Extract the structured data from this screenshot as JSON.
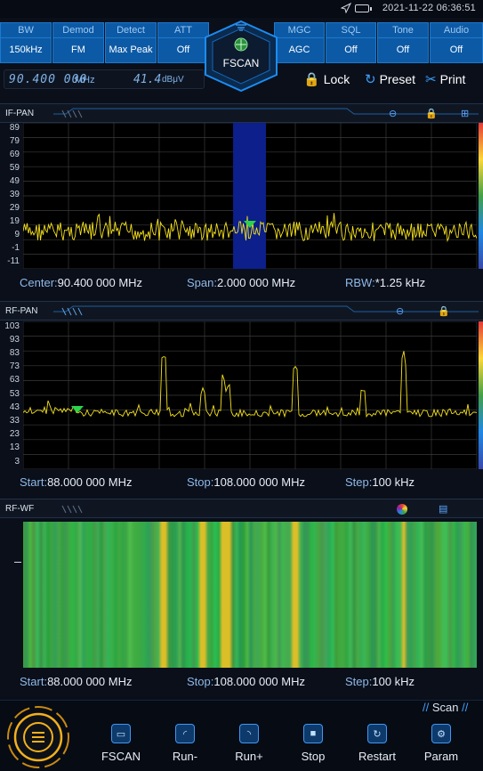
{
  "status": {
    "datetime": "2021-11-22 06:36:51"
  },
  "params": [
    {
      "label": "BW",
      "value": "150kHz"
    },
    {
      "label": "Demod",
      "value": "FM"
    },
    {
      "label": "Detect",
      "value": "Max Peak"
    },
    {
      "label": "ATT",
      "value": "Off"
    },
    {
      "label": "MGC",
      "value": "AGC"
    },
    {
      "label": "SQL",
      "value": "Off"
    },
    {
      "label": "Tone",
      "value": "Off"
    },
    {
      "label": "Audio",
      "value": "Off"
    }
  ],
  "mode": "FSCAN",
  "readout": {
    "freq": "90.400 000",
    "freq_unit": "MHz",
    "level": "41.4",
    "level_unit": "dBμV"
  },
  "actions": {
    "lock": "Lock",
    "preset": "Preset",
    "print": "Print"
  },
  "if_pan": {
    "title": "IF-PAN",
    "y_ticks": [
      "89",
      "79",
      "69",
      "59",
      "49",
      "39",
      "29",
      "19",
      "9",
      "-1",
      "-11"
    ],
    "center_label": "Center:",
    "center_value": "90.400 000 MHz",
    "span_label": "Span:",
    "span_value": "2.000 000 MHz",
    "rbw_label": "RBW:",
    "rbw_value": "*1.25 kHz"
  },
  "rf_pan": {
    "title": "RF-PAN",
    "y_ticks": [
      "103",
      "93",
      "83",
      "73",
      "63",
      "53",
      "43",
      "33",
      "23",
      "13",
      "3"
    ],
    "start_label": "Start:",
    "start_value": "88.000 000 MHz",
    "stop_label": "Stop:",
    "stop_value": "108.000 000 MHz",
    "step_label": "Step:",
    "step_value": "100 kHz"
  },
  "rf_wf": {
    "title": "RF-WF",
    "start_label": "Start:",
    "start_value": "88.000 000 MHz",
    "stop_label": "Stop:",
    "stop_value": "108.000 000 MHz",
    "step_label": "Step:",
    "step_value": "100 kHz"
  },
  "scan_label": "Scan",
  "bottom": [
    {
      "label": "FSCAN",
      "icon": "fscan-icon"
    },
    {
      "label": "Run-",
      "icon": "run-minus-icon"
    },
    {
      "label": "Run+",
      "icon": "run-plus-icon"
    },
    {
      "label": "Stop",
      "icon": "stop-icon"
    },
    {
      "label": "Restart",
      "icon": "restart-icon"
    },
    {
      "label": "Param",
      "icon": "param-icon"
    }
  ]
}
